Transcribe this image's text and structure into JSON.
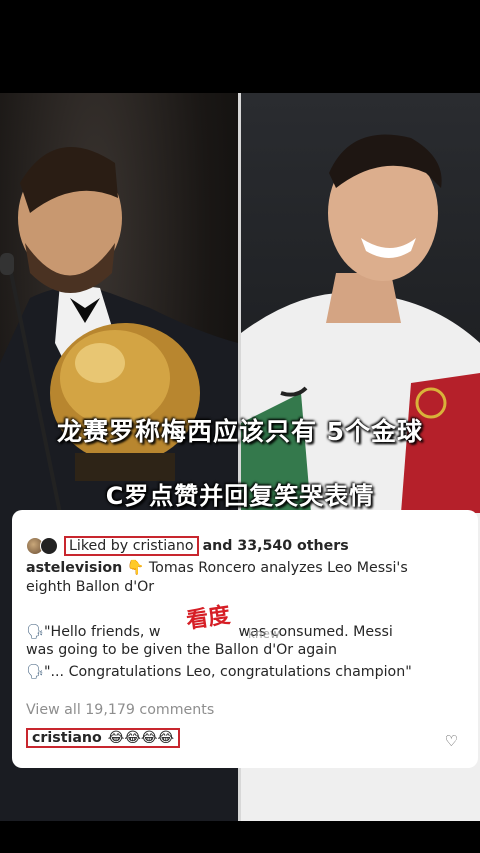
{
  "headline": {
    "line1": "龙赛罗称梅西应该只有 5个金球",
    "line2": "C罗点赞并回复笑哭表情"
  },
  "post": {
    "liked_by": "Liked by cristiano",
    "others": "and 33,540 others",
    "caption_user": "astelevision",
    "caption_emoji": "👇",
    "caption_line1": "Tomas Roncero analyzes Leo Messi's",
    "caption_line2": "eighth Ballon d'Or",
    "speech_emoji": "🗣",
    "quote1_a": "\"Hello friends, w",
    "quote1_b": "was consumed. Messi",
    "quote2": "was going to be given the Ballon d'Or again",
    "quote3": "\"... Congratulations Leo, congratulations champion\"",
    "view_all": "View all 19,179 comments",
    "comment_user": "cristiano",
    "comment_emojis": "😂😂😂😂"
  },
  "overlay": {
    "stamp": "看度",
    "watermark": "knew"
  },
  "colors": {
    "highlight_red": "#c8262e",
    "portugal_red": "#b5202a",
    "portugal_green": "#1f6b3a"
  },
  "icons": [
    "speaking-head-icon",
    "pointing-down-icon",
    "heart-icon",
    "laughing-emoji-icon"
  ]
}
